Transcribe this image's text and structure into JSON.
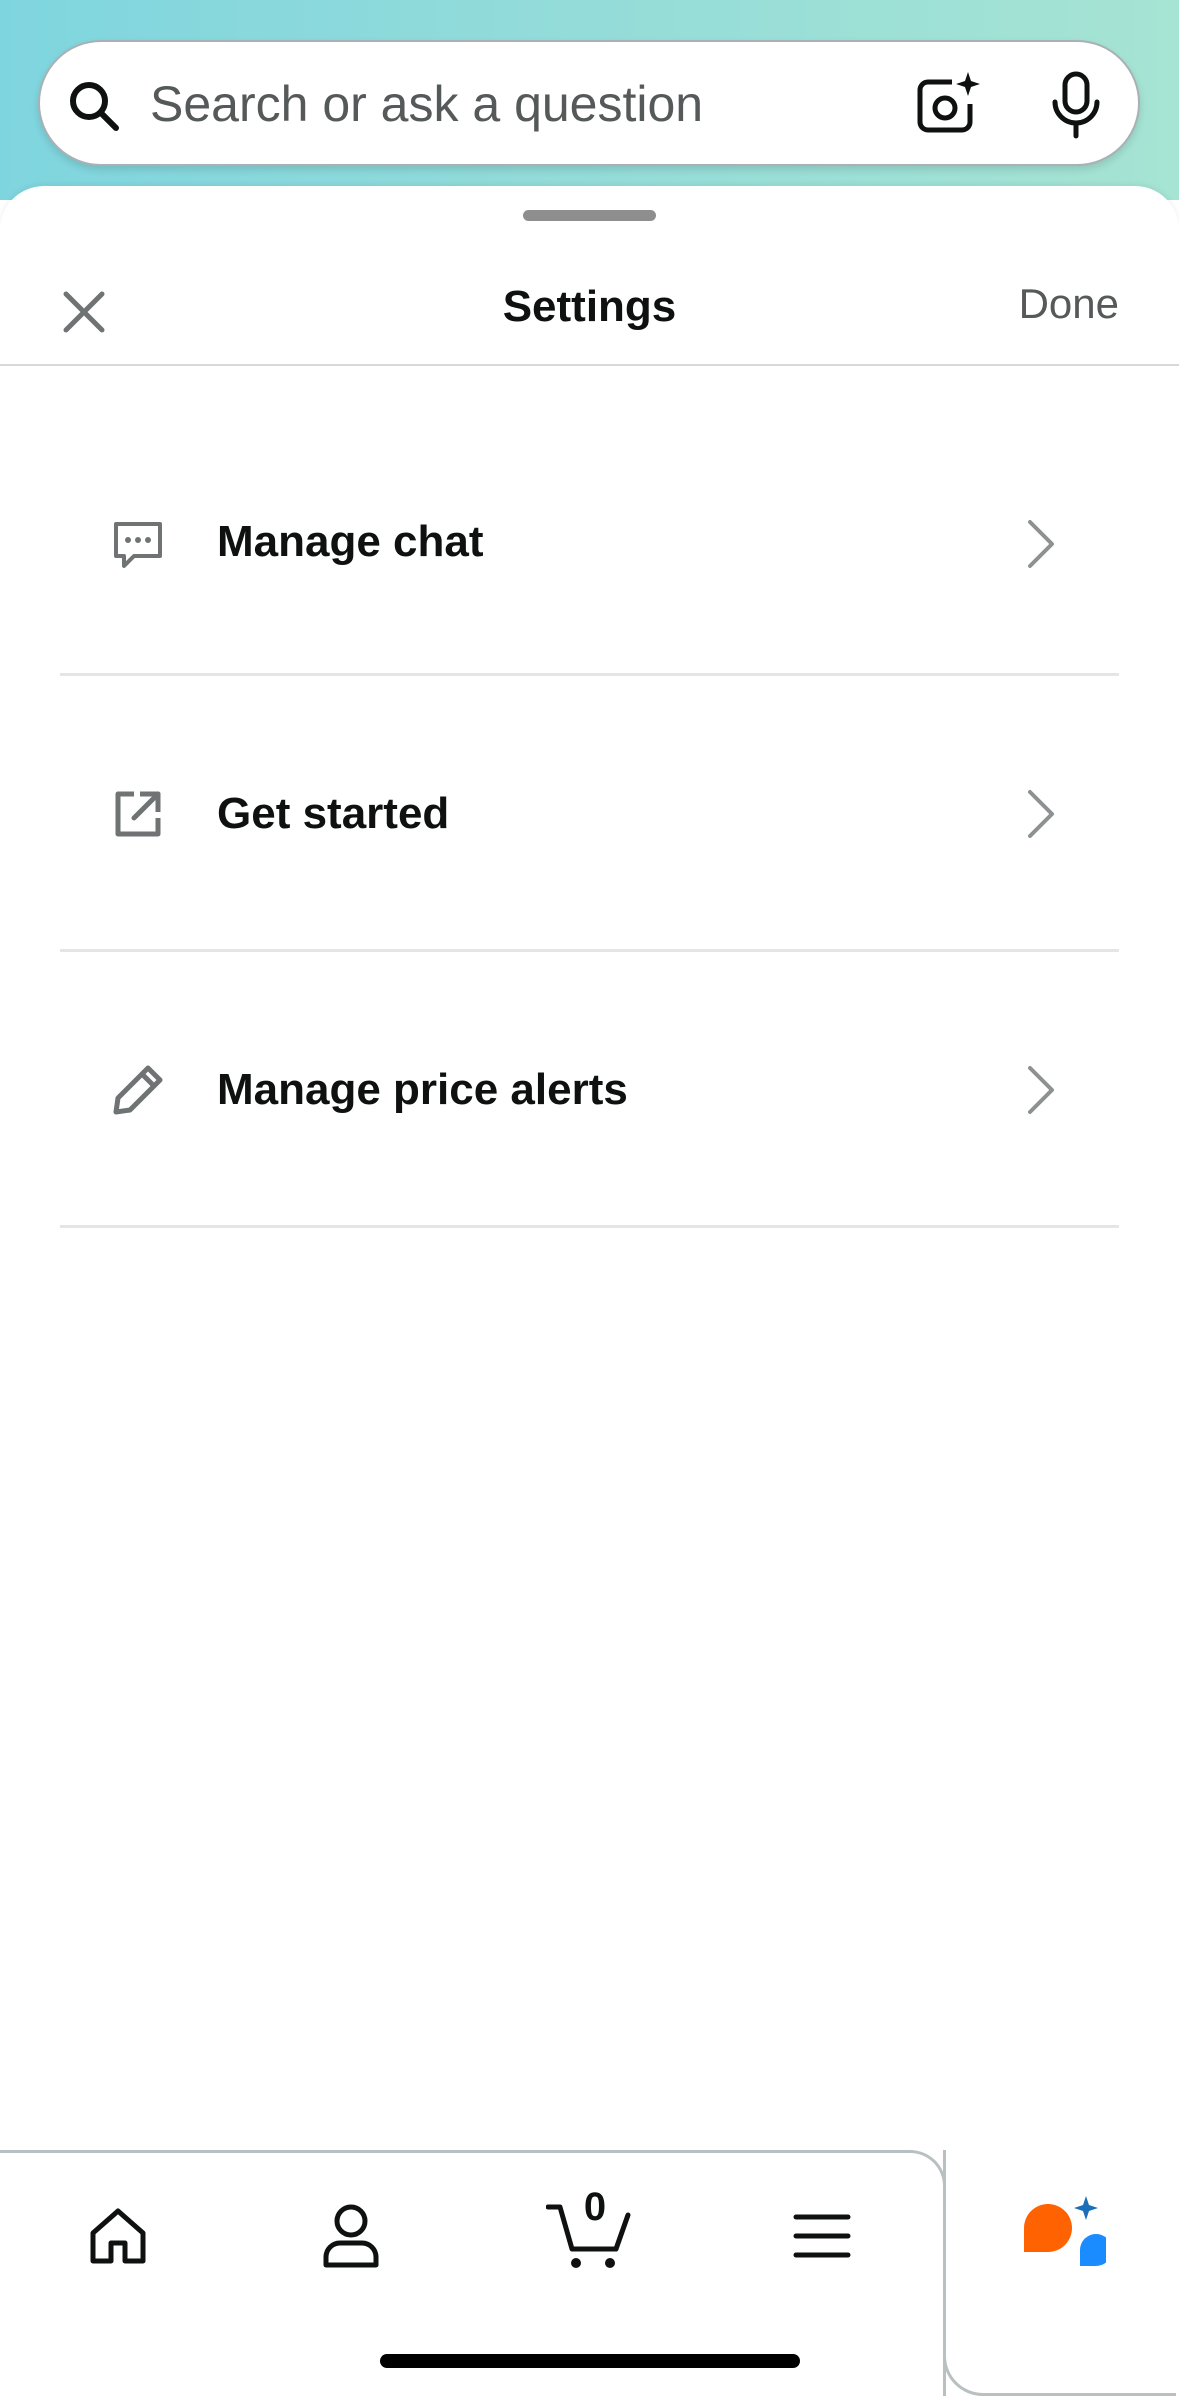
{
  "search": {
    "placeholder": "Search or ask a question",
    "value": ""
  },
  "sheet": {
    "title": "Settings",
    "done_label": "Done"
  },
  "settings": {
    "items": [
      {
        "label": "Manage chat",
        "icon": "chat-bubble-icon"
      },
      {
        "label": "Get started",
        "icon": "external-link-icon"
      },
      {
        "label": "Manage price alerts",
        "icon": "pencil-icon"
      }
    ]
  },
  "nav": {
    "cart_count": "0",
    "items": [
      "home-icon",
      "account-icon",
      "cart-icon",
      "menu-icon",
      "rufus-icon"
    ]
  },
  "colors": {
    "gradient_start": "#7fd5df",
    "gradient_end": "#a6e4d3",
    "rufus_orange": "#ff6200",
    "rufus_blue": "#1a8cff",
    "text_primary": "#0f1111",
    "text_secondary": "#565959"
  }
}
